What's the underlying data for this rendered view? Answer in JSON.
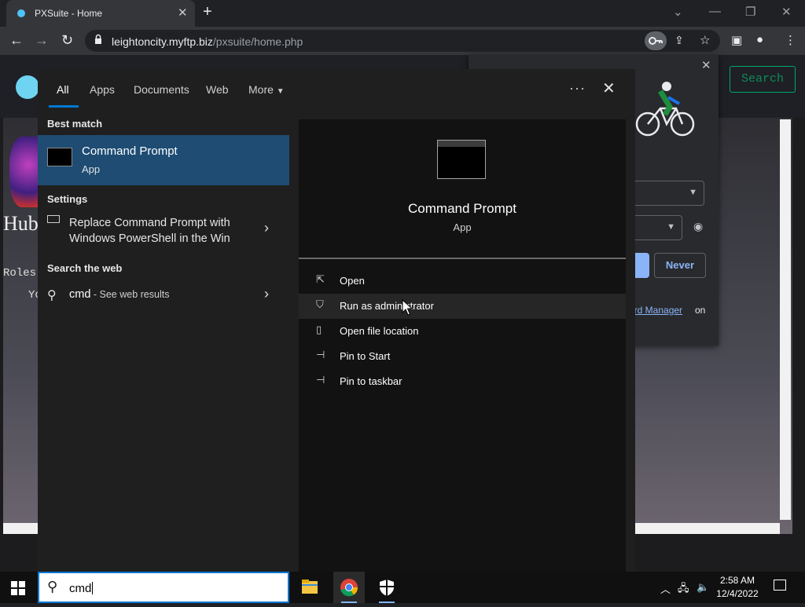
{
  "browser": {
    "tab_title": "PXSuite - Home",
    "url_host": "leightoncity.myftp.biz",
    "url_path": "/pxsuite/home.php"
  },
  "page": {
    "search_label": "Search",
    "hub_text": "Hub",
    "roles_text": "Roles",
    "yo_text": "Yo"
  },
  "password_popup": {
    "never_label": "Never",
    "manager_link": "ord Manager",
    "on_text": "on"
  },
  "search": {
    "tabs": {
      "all": "All",
      "apps": "Apps",
      "documents": "Documents",
      "web": "Web",
      "more": "More"
    },
    "best_match_heading": "Best match",
    "best_match": {
      "title": "Command Prompt",
      "subtitle": "App"
    },
    "settings_heading": "Settings",
    "setting_item": "Replace Command Prompt with Windows PowerShell in the Win",
    "web_heading": "Search the web",
    "web_query": "cmd",
    "web_suffix": " - See web results",
    "detail": {
      "title": "Command Prompt",
      "subtitle": "App"
    },
    "actions": [
      {
        "label": "Open"
      },
      {
        "label": "Run as administrator"
      },
      {
        "label": "Open file location"
      },
      {
        "label": "Pin to Start"
      },
      {
        "label": "Pin to taskbar"
      }
    ]
  },
  "taskbar": {
    "search_text": "cmd",
    "time": "2:58 AM",
    "date": "12/4/2022"
  },
  "colors": {
    "accent": "#0078d4",
    "best_match_bg": "#1e4c73",
    "page_search_green": "#00a86b"
  }
}
